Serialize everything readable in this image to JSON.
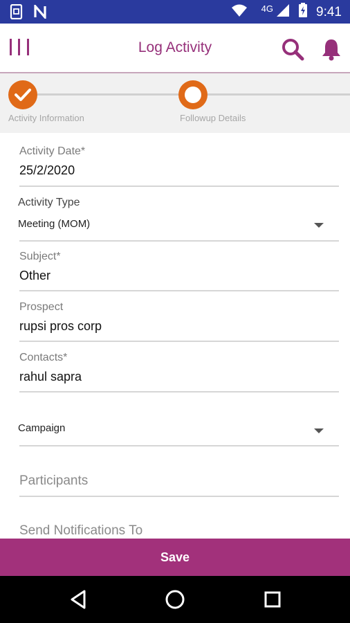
{
  "status_bar": {
    "time": "9:41",
    "network": "4G",
    "left_icons": [
      "screenshot-icon",
      "n-notification-icon"
    ],
    "right_icons": [
      "wifi-icon",
      "cellular-signal-icon",
      "battery-charging-icon"
    ]
  },
  "app_bar": {
    "title": "Log Activity",
    "icons": [
      "menu-icon",
      "search-icon",
      "bell-icon"
    ],
    "accent_color": "#96307a"
  },
  "stepper": {
    "steps": [
      {
        "label": "Activity Information",
        "state": "completed"
      },
      {
        "label": "Followup Details",
        "state": "current"
      }
    ],
    "step_color": "#e06a18"
  },
  "form": {
    "activity_date": {
      "label": "Activity Date*",
      "value": "25/2/2020"
    },
    "activity_type": {
      "label": "Activity Type",
      "value": "Meeting (MOM)"
    },
    "subject": {
      "label": "Subject*",
      "value": "Other"
    },
    "prospect": {
      "label": "Prospect",
      "value": "rupsi pros corp"
    },
    "contacts": {
      "label": "Contacts*",
      "value": "rahul sapra"
    },
    "campaign": {
      "placeholder": "Campaign"
    },
    "participants": {
      "placeholder": "Participants"
    },
    "send_notifications": {
      "placeholder": "Send Notifications To"
    }
  },
  "footer": {
    "save_label": "Save",
    "save_color": "#a2317b"
  },
  "nav_bar": {
    "buttons": [
      "back-icon",
      "home-icon",
      "recents-icon"
    ]
  }
}
